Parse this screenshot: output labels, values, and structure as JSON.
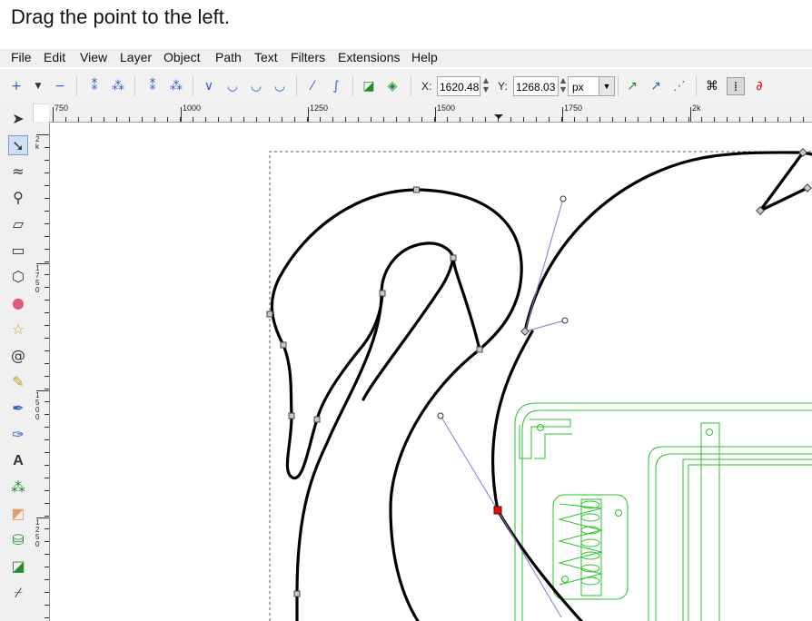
{
  "instruction": "Drag the point to the left.",
  "menu": [
    "File",
    "Edit",
    "View",
    "Layer",
    "Object",
    "Path",
    "Text",
    "Filters",
    "Extensions",
    "Help"
  ],
  "controls": {
    "x_label": "X:",
    "x_value": "1620.48",
    "y_label": "Y:",
    "y_value": "1268.03",
    "unit": "px"
  },
  "ruler": {
    "h_labels": [
      "750",
      "1000",
      "1250",
      "1500",
      "1750",
      "2k"
    ],
    "v_labels": [
      "2k",
      "1750",
      "1500",
      "1250"
    ]
  },
  "colors": {
    "selected_node": "#e01010",
    "handle_line": "#7b7bd4",
    "path": "#000000",
    "green_outline": "#27c427"
  },
  "icons": {
    "selector": "arrow-icon",
    "node_editor": "node-tool-icon"
  }
}
